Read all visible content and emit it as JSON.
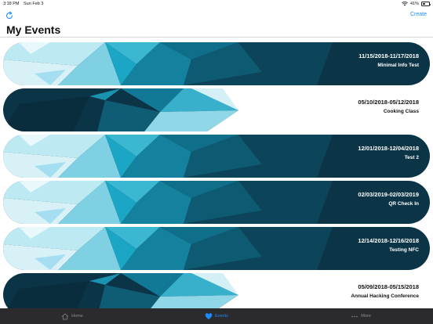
{
  "status_bar": {
    "time": "3:18 PM",
    "date": "Sun Feb 3",
    "battery": "41%"
  },
  "nav": {
    "create_label": "Create",
    "title": "My Events"
  },
  "events": [
    {
      "date_range": "11/15/2018-11/17/2018",
      "name": "Minimal Info Test",
      "style": "full"
    },
    {
      "date_range": "05/10/2018-05/12/2018",
      "name": "Cooking Class",
      "style": "partial"
    },
    {
      "date_range": "12/01/2018-12/04/2018",
      "name": "Test 2",
      "style": "full"
    },
    {
      "date_range": "02/03/2019-02/03/2019",
      "name": "QR Check In",
      "style": "full"
    },
    {
      "date_range": "12/14/2018-12/16/2018",
      "name": "Testing NFC",
      "style": "full"
    },
    {
      "date_range": "05/09/2018-05/15/2018",
      "name": "Annual Hacking Conference",
      "style": "partial"
    }
  ],
  "tabs": [
    {
      "label": "Home",
      "icon": "home-icon",
      "active": false
    },
    {
      "label": "Events",
      "icon": "heart-icon",
      "active": true
    },
    {
      "label": "More",
      "icon": "more-icon",
      "active": false
    }
  ],
  "colors": {
    "accent": "#1a8cff",
    "dark_navy": "#0b3447",
    "teal": "#1aa6c4",
    "light_cyan": "#bde9f3",
    "tab_bar": "#2b2b2d"
  }
}
